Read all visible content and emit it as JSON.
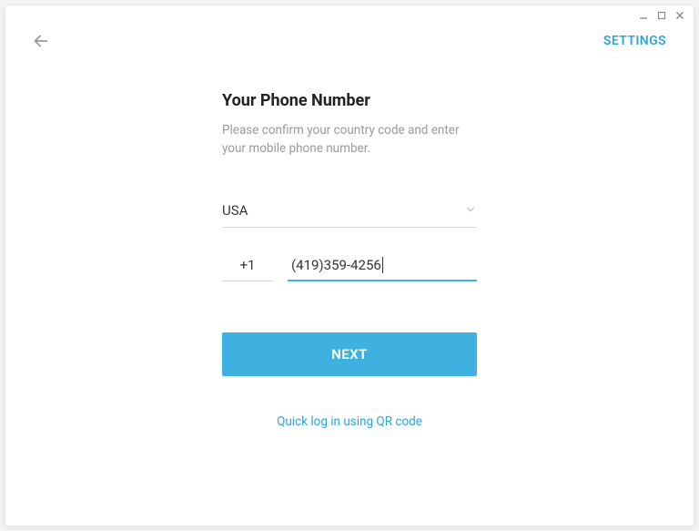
{
  "window": {
    "settings_label": "SETTINGS"
  },
  "form": {
    "title": "Your Phone Number",
    "subtitle": "Please confirm your country code and enter your mobile phone number.",
    "country": "USA",
    "dial_code": "+1",
    "phone_value": "(419)359-4256",
    "next_label": "NEXT",
    "qr_link": "Quick log in using QR code"
  }
}
